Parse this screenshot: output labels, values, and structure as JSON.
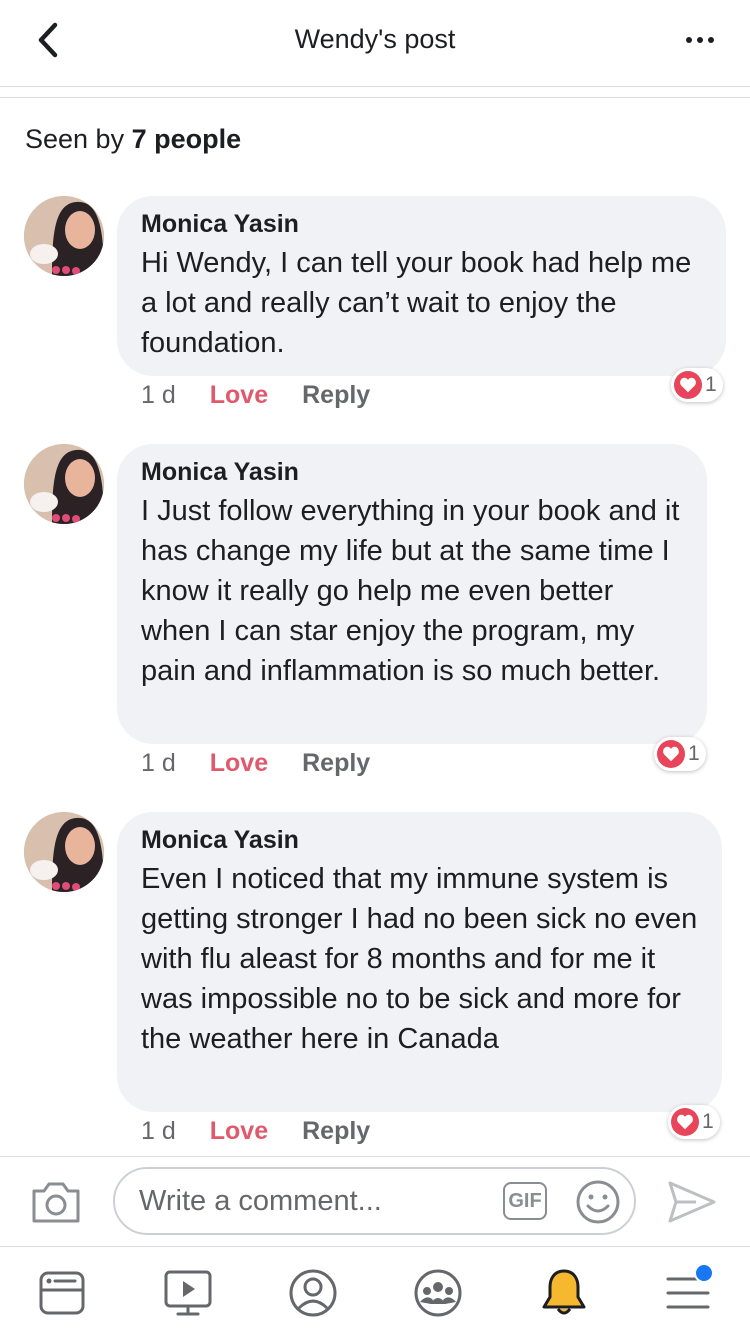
{
  "header": {
    "title": "Wendy's post"
  },
  "seen": {
    "prefix": "Seen by ",
    "count": "7 people"
  },
  "comments": [
    {
      "author": "Monica Yasin",
      "body": "Hi Wendy, I can tell your book had help me a lot and really can’t wait to enjoy the foundation.",
      "time": "1 d",
      "love": "Love",
      "reply": "Reply",
      "reaction_count": "1"
    },
    {
      "author": "Monica Yasin",
      "body": "I Just follow everything in your book and it has change my life but at the same time I know it really go help me even better when I can star enjoy the program, my pain and inflammation is so much better.",
      "time": "1 d",
      "love": "Love",
      "reply": "Reply",
      "reaction_count": "1"
    },
    {
      "author": "Monica Yasin",
      "body": "Even I noticed that my immune system is getting stronger I had no been sick no even with flu aleast for 8 months and for me it was impossible no to be sick and more for the weather here in Canada",
      "time": "1 d",
      "love": "Love",
      "reply": "Reply",
      "reaction_count": "1"
    }
  ],
  "composer": {
    "placeholder": "Write a comment...",
    "gif_label": "GIF"
  },
  "icons": {
    "back": "chevron-left-icon",
    "more": "more-dots-icon",
    "camera": "camera-icon",
    "emoji": "emoji-icon",
    "send": "send-icon",
    "heart": "heart-icon",
    "tabs": [
      "news-feed-icon",
      "watch-icon",
      "profile-icon",
      "groups-icon",
      "notifications-icon",
      "menu-icon"
    ]
  },
  "colors": {
    "love": "#e0596d",
    "reaction_heart": "#e8455a",
    "bubble": "#f0f2f5",
    "notif_dot": "#1877f2",
    "bell_active": "#f5b82e"
  }
}
